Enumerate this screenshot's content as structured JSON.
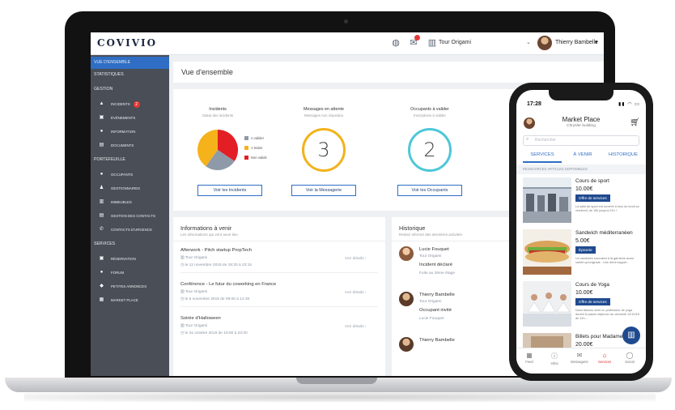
{
  "app": {
    "logo": "COVIVIO",
    "building": "Tour Origami",
    "user": "Thierry Bambelle"
  },
  "sidebar": {
    "items": [
      {
        "label": "VUE D'ENSEMBLE",
        "type": "section",
        "active": true
      },
      {
        "label": "STATISTIQUES",
        "type": "section"
      },
      {
        "label": "GESTION",
        "type": "section"
      },
      {
        "label": "INCIDENTS",
        "type": "sub",
        "icon": "warning-icon",
        "badge": "2"
      },
      {
        "label": "ÉVÉNEMENTS",
        "type": "sub",
        "icon": "calendar-icon"
      },
      {
        "label": "INFORMATION",
        "type": "sub",
        "icon": "info-icon"
      },
      {
        "label": "DOCUMENTS",
        "type": "sub",
        "icon": "document-icon"
      },
      {
        "label": "PORTEFEUILLE",
        "type": "section"
      },
      {
        "label": "OCCUPANTS",
        "type": "sub",
        "icon": "person-icon"
      },
      {
        "label": "GESTIONNAIRES",
        "type": "sub",
        "icon": "manager-icon"
      },
      {
        "label": "IMMEUBLES",
        "type": "sub",
        "icon": "building-icon"
      },
      {
        "label": "GESTION DES CONTACTS",
        "type": "sub",
        "icon": "contact-card-icon"
      },
      {
        "label": "CONTACTS D'URGENCE",
        "type": "sub",
        "icon": "phone-icon"
      },
      {
        "label": "SERVICES",
        "type": "section"
      },
      {
        "label": "RÉSERVATION",
        "type": "sub",
        "icon": "calendar-icon"
      },
      {
        "label": "FORUM",
        "type": "sub",
        "icon": "chat-icon"
      },
      {
        "label": "PETITES ANNONCES",
        "type": "sub",
        "icon": "tag-icon"
      },
      {
        "label": "MARKET PLACE",
        "type": "sub",
        "icon": "store-icon"
      }
    ]
  },
  "main": {
    "title": "Vue d'ensemble",
    "stats": {
      "incidents": {
        "title": "Incidents",
        "subtitle": "Statut des incidents",
        "button": "Voir les Incidents",
        "legend": [
          {
            "label": "A valider",
            "color": "#8e9aa8"
          },
          {
            "label": "A traiter",
            "color": "#f5b21b"
          },
          {
            "label": "Non validé",
            "color": "#e31e24"
          }
        ]
      },
      "messages": {
        "title": "Messages en attente",
        "subtitle": "Messages non répondus",
        "value": "3",
        "button": "Voir la Messagerie"
      },
      "occupants": {
        "title": "Occupants à valider",
        "subtitle": "Inscriptions à valider",
        "value": "2",
        "button": "Voir les Occupants"
      }
    },
    "info": {
      "title": "Informations à venir",
      "subtitle": "Les informations qui vont avoir lieu",
      "details_label": "Voir détails",
      "events": [
        {
          "title": "Afterwork - Pitch startup PropTech",
          "location": "Tour Origami",
          "date": "le 12 novembre 2019 de 18:30 à 23:15"
        },
        {
          "title": "Conférence - Le futur du coworking en France",
          "location": "Tour Origami",
          "date": "le 5 novembre 2019 de 09:00 à 12:30"
        },
        {
          "title": "Soirée d'Halloween",
          "location": "Tour Origami",
          "date": "le 31 octobre 2019 de 19:00 à 23:30"
        }
      ]
    },
    "history": {
      "title": "Historique",
      "subtitle": "Restez informé des dernières activités",
      "entries": [
        {
          "name": "Lucie Fouquet",
          "location": "Tour Origami",
          "action": "Incident déclaré",
          "desc": "Fuite au 2ème étage"
        },
        {
          "name": "Thierry Bambelle",
          "location": "Tour Origami",
          "action": "Occupant invité",
          "desc": "Lucie Fouquet"
        },
        {
          "name": "Thierry Bambelle",
          "location": "",
          "action": "",
          "desc": ""
        }
      ]
    }
  },
  "phone": {
    "time": "17:28",
    "title": "Market Place",
    "subtitle": "Chrysler building",
    "search_placeholder": "Rechercher",
    "tabs": [
      "SERVICES",
      "À VENIR",
      "HISTORIQUE"
    ],
    "section": "RESSOURCES ARTICLES DISPONIBLES",
    "resources": [
      {
        "title": "Cours de sport",
        "price": "10.00€",
        "tag": "Offre de services",
        "desc": "La salle de sport est ouverte à tous du lundi au vendredi, de 15h jusqu'à 22h !"
      },
      {
        "title": "Sandwich méditerranéen",
        "price": "5.00€",
        "tag": "Épicerie",
        "desc": "Un sandwich succulent à la garniture aussi variée qu'originale - Une demi baguet..."
      },
      {
        "title": "Cours de Yoga",
        "price": "10.00€",
        "tag": "Offre de services",
        "desc": "Nous faisons venir un professeur de yoga durant la pause déjeuner du vendredi 12/10/18 de 12h..."
      },
      {
        "title": "Billets pour Madame",
        "price": "20.00€",
        "tag": "",
        "desc": ""
      }
    ],
    "nav": [
      {
        "label": "Feed",
        "icon": "grid-icon"
      },
      {
        "label": "Infos",
        "icon": "info-icon"
      },
      {
        "label": "Messagerie",
        "icon": "mail-icon"
      },
      {
        "label": "Services",
        "icon": "services-icon",
        "active": true
      },
      {
        "label": "Social",
        "icon": "chat-icon"
      }
    ]
  },
  "colors": {
    "accent": "#2f6ec4",
    "sidebar": "#4a4e56",
    "navy": "#1f4a8f",
    "ring_orange": "#f3b21b",
    "ring_teal": "#4dc7d9",
    "alert": "#e31e24"
  }
}
